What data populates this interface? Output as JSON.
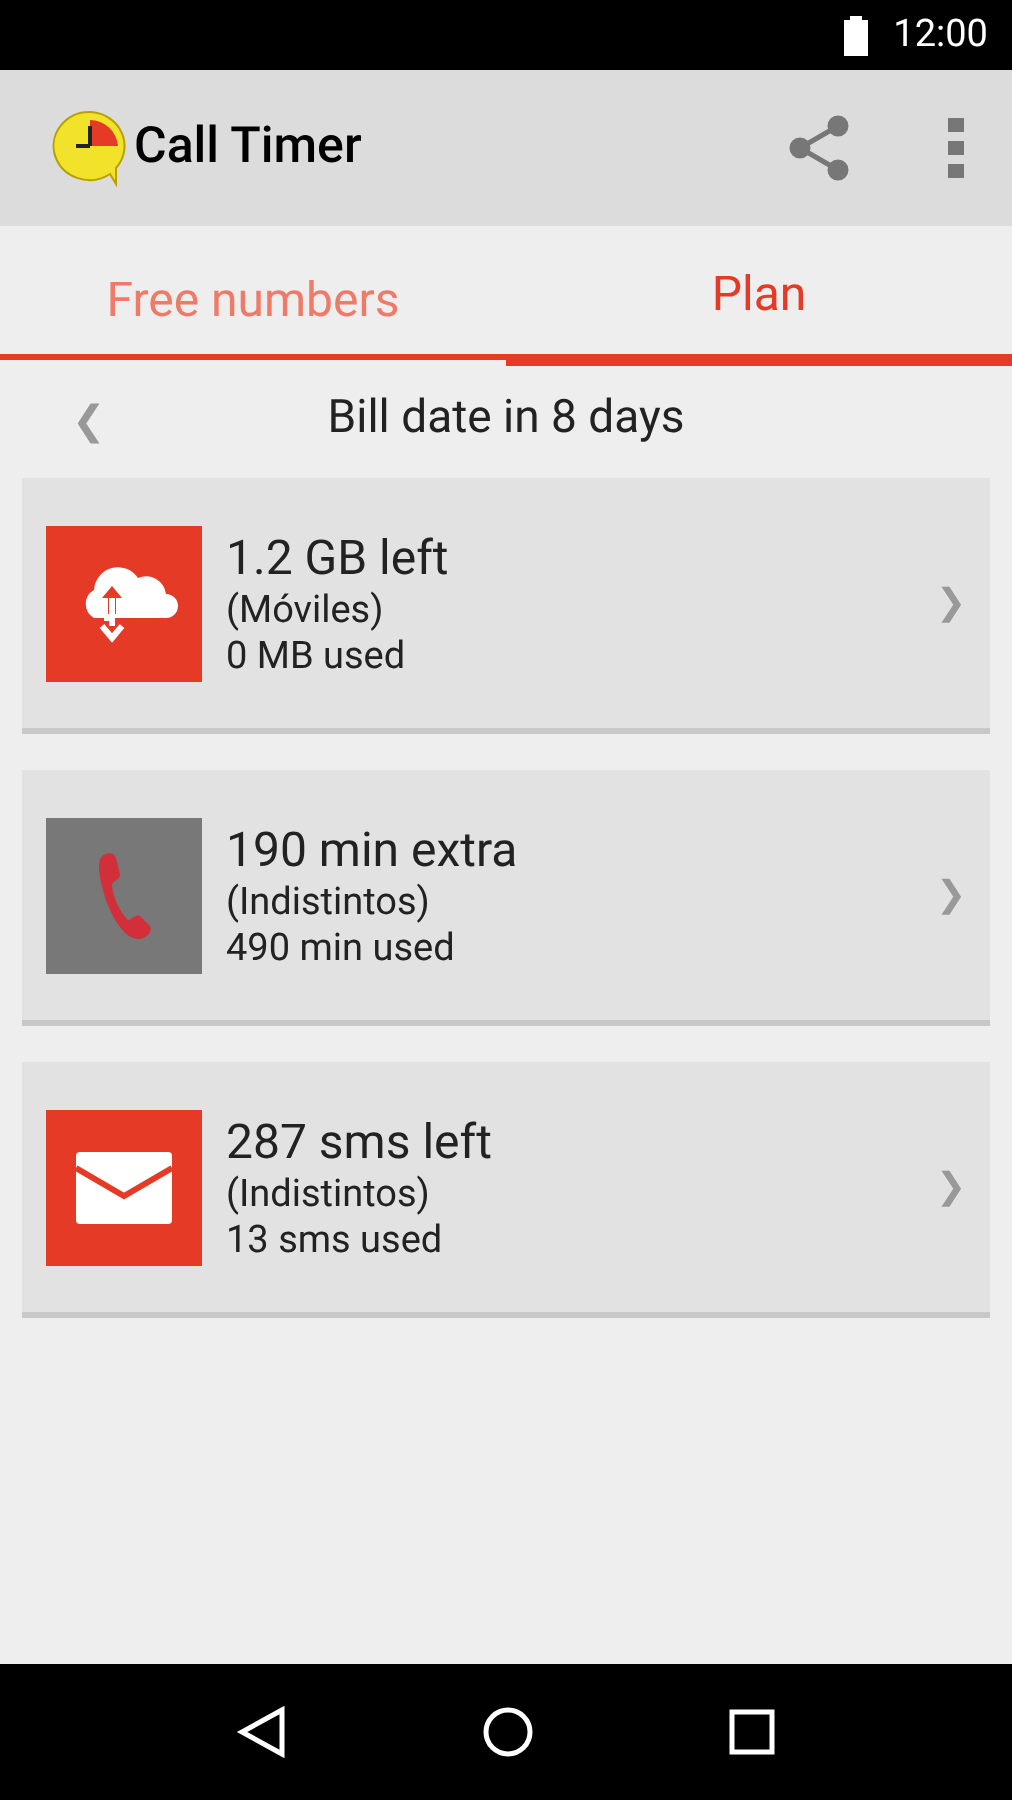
{
  "status_bar": {
    "time": "12:00"
  },
  "app_bar": {
    "title": "Call Timer"
  },
  "tabs": [
    {
      "label": "Free numbers",
      "selected": false
    },
    {
      "label": "Plan",
      "selected": true
    }
  ],
  "period": {
    "prev": "❮",
    "label": "Bill date in 8 days"
  },
  "cards": [
    {
      "kind": "data",
      "color": "#e53a25",
      "title": "1.2 GB left",
      "subtitle": "(Móviles)",
      "usage": "0 MB used",
      "chevron": "❯"
    },
    {
      "kind": "calls",
      "color": "#787878",
      "title": "190 min extra",
      "subtitle": "(Indistintos)",
      "usage": "490 min used",
      "chevron": "❯"
    },
    {
      "kind": "sms",
      "color": "#e53a25",
      "title": "287 sms left",
      "subtitle": "(Indistintos)",
      "usage": "13 sms used",
      "chevron": "❯"
    }
  ]
}
